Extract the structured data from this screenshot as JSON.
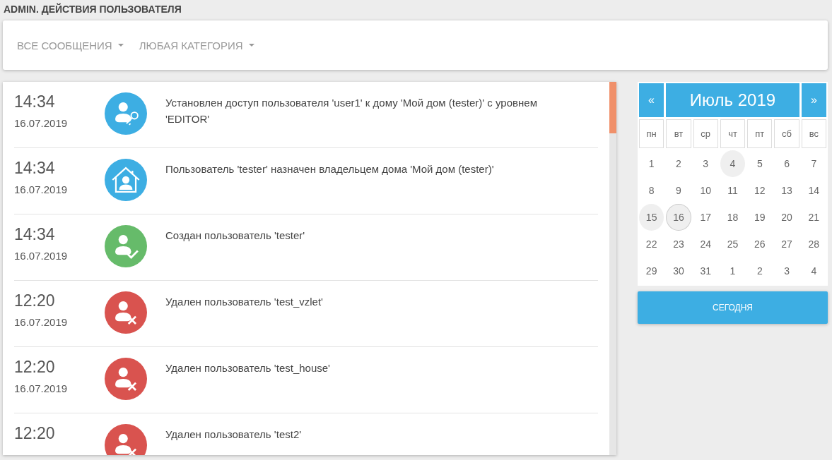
{
  "page_title": "ADMIN. ДЕЙСТВИЯ ПОЛЬЗОВАТЕЛЯ",
  "filters": [
    {
      "label": "ВСЕ СООБЩЕНИЯ"
    },
    {
      "label": "ЛЮБАЯ КАТЕГОРИЯ"
    }
  ],
  "events": [
    {
      "time": "14:34",
      "date": "16.07.2019",
      "kind": "access",
      "message": "Установлен доступ пользователя 'user1' к дому 'Мой дом (tester)' с уровнем 'EDITOR'"
    },
    {
      "time": "14:34",
      "date": "16.07.2019",
      "kind": "owner",
      "message": "Пользователь 'tester' назначен владельцем дома 'Мой дом (tester)'"
    },
    {
      "time": "14:34",
      "date": "16.07.2019",
      "kind": "created",
      "message": "Создан пользователь 'tester'"
    },
    {
      "time": "12:20",
      "date": "16.07.2019",
      "kind": "deleted",
      "message": "Удален пользователь 'test_vzlet'"
    },
    {
      "time": "12:20",
      "date": "16.07.2019",
      "kind": "deleted",
      "message": "Удален пользователь 'test_house'"
    },
    {
      "time": "12:20",
      "kind": "deleted",
      "message": "Удален пользователь 'test2'"
    }
  ],
  "calendar": {
    "prev": "«",
    "title": "Июль 2019",
    "next": "»",
    "weekdays": [
      "пн",
      "вт",
      "ср",
      "чт",
      "пт",
      "сб",
      "вс"
    ],
    "days": [
      {
        "label": "1",
        "highlighted": false,
        "selected": false
      },
      {
        "label": "2",
        "highlighted": false,
        "selected": false
      },
      {
        "label": "3",
        "highlighted": false,
        "selected": false
      },
      {
        "label": "4",
        "highlighted": true,
        "selected": false
      },
      {
        "label": "5",
        "highlighted": false,
        "selected": false
      },
      {
        "label": "6",
        "highlighted": false,
        "selected": false
      },
      {
        "label": "7",
        "highlighted": false,
        "selected": false
      },
      {
        "label": "8",
        "highlighted": false,
        "selected": false
      },
      {
        "label": "9",
        "highlighted": false,
        "selected": false
      },
      {
        "label": "10",
        "highlighted": false,
        "selected": false
      },
      {
        "label": "11",
        "highlighted": false,
        "selected": false
      },
      {
        "label": "12",
        "highlighted": false,
        "selected": false
      },
      {
        "label": "13",
        "highlighted": false,
        "selected": false
      },
      {
        "label": "14",
        "highlighted": false,
        "selected": false
      },
      {
        "label": "15",
        "highlighted": true,
        "selected": false
      },
      {
        "label": "16",
        "highlighted": true,
        "selected": true
      },
      {
        "label": "17",
        "highlighted": false,
        "selected": false
      },
      {
        "label": "18",
        "highlighted": false,
        "selected": false
      },
      {
        "label": "19",
        "highlighted": false,
        "selected": false
      },
      {
        "label": "20",
        "highlighted": false,
        "selected": false
      },
      {
        "label": "21",
        "highlighted": false,
        "selected": false
      },
      {
        "label": "22",
        "highlighted": false,
        "selected": false
      },
      {
        "label": "23",
        "highlighted": false,
        "selected": false
      },
      {
        "label": "24",
        "highlighted": false,
        "selected": false
      },
      {
        "label": "25",
        "highlighted": false,
        "selected": false
      },
      {
        "label": "26",
        "highlighted": false,
        "selected": false
      },
      {
        "label": "27",
        "highlighted": false,
        "selected": false
      },
      {
        "label": "28",
        "highlighted": false,
        "selected": false
      },
      {
        "label": "29",
        "highlighted": false,
        "selected": false
      },
      {
        "label": "30",
        "highlighted": false,
        "selected": false
      },
      {
        "label": "31",
        "highlighted": false,
        "selected": false
      },
      {
        "label": "1",
        "highlighted": false,
        "selected": false
      },
      {
        "label": "2",
        "highlighted": false,
        "selected": false
      },
      {
        "label": "3",
        "highlighted": false,
        "selected": false
      },
      {
        "label": "4",
        "highlighted": false,
        "selected": false
      }
    ],
    "today_button": "СЕГОДНЯ"
  }
}
